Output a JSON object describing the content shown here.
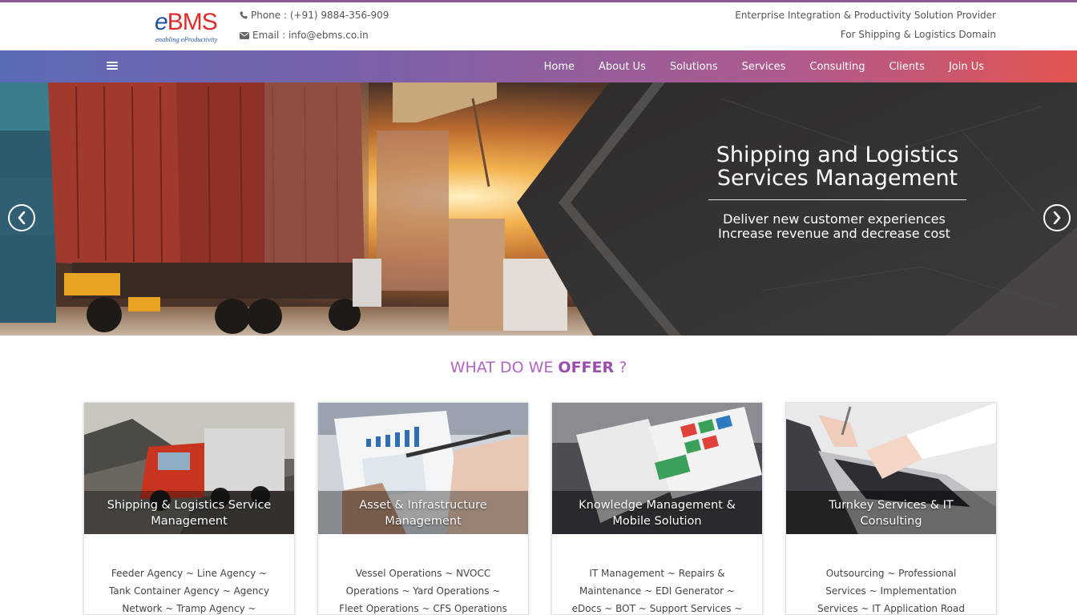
{
  "brand": {
    "logo_e": "e",
    "logo_bms": "BMS",
    "logo_tagline": "enabling eProductivity"
  },
  "contact": {
    "phone": "Phone : (+91) 9884-356-909",
    "email": "Email : info@ebms.co.in"
  },
  "tagline": {
    "line1": "Enterprise Integration & Productivity Solution Provider",
    "line2": "For Shipping & Logistics Domain"
  },
  "nav": {
    "items": [
      "Home",
      "About Us",
      "Solutions",
      "Services",
      "Consulting",
      "Clients",
      "Join Us"
    ]
  },
  "hero": {
    "title_line1": "Shipping and Logistics",
    "title_line2": "Services Management",
    "sub_line1": "Deliver new customer experiences",
    "sub_line2": "Increase revenue and decrease cost"
  },
  "offer": {
    "heading_prefix": "WHAT DO WE",
    "heading_bold": "OFFER",
    "heading_suffix": "?",
    "cards": [
      {
        "title_line1": "Shipping & Logistics Service",
        "title_line2": "Management",
        "text_lines": [
          "Feeder Agency ~ Line Agency ~",
          "Tank Container Agency ~ Agency",
          "Network ~ Tramp Agency ~"
        ]
      },
      {
        "title_line1": "Asset & Infrastructure",
        "title_line2": "Management",
        "text_lines": [
          "Vessel Operations ~ NVOCC",
          "Operations ~ Yard Operations ~",
          "Fleet Operations ~ CFS Operations"
        ]
      },
      {
        "title_line1": "Knowledge Management &",
        "title_line2": "Mobile Solution",
        "text_lines": [
          "IT Management ~ Repairs &",
          "Maintenance ~ EDI Generator ~",
          "eDocs ~ BOT ~ Support Services ~"
        ]
      },
      {
        "title_line1": "Turnkey Services & IT",
        "title_line2": "Consulting",
        "text_lines": [
          "Outsourcing ~ Professional",
          "Services ~ Implementation",
          "Services ~ IT Application Road"
        ]
      }
    ]
  },
  "colors": {
    "nav_gradient_start": "#5b6bb8",
    "nav_gradient_end": "#e2544f",
    "logo_blue": "#1e4fa3",
    "logo_red": "#e02b2b",
    "heading_purple": "#b165c2"
  },
  "icons": {
    "phone": "phone-icon",
    "email": "envelope-icon",
    "menu": "hamburger-menu-icon",
    "prev": "chevron-left-icon",
    "next": "chevron-right-icon"
  }
}
